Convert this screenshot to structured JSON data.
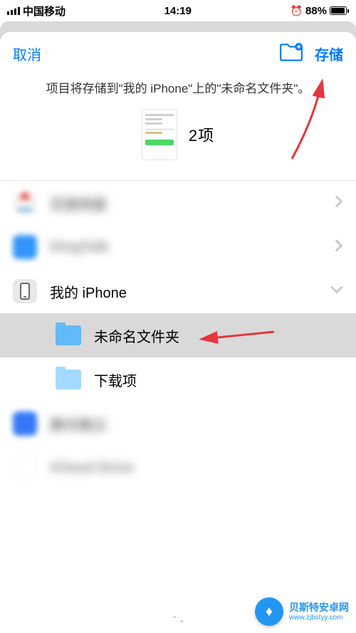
{
  "status": {
    "carrier": "中国移动",
    "time": "14:19",
    "battery": "88%"
  },
  "header": {
    "cancel": "取消",
    "save": "存储"
  },
  "description": "项目将存储到\"我的 iPhone\"上的\"未命名文件夹\"。",
  "preview": {
    "count": "2项"
  },
  "locations": [
    {
      "label": "百度网盘",
      "blurred": true,
      "iconColor": "#f5f5f5"
    },
    {
      "label": "DingTalk",
      "blurred": true,
      "iconColor": "#3296fa"
    },
    {
      "label": "我的 iPhone",
      "type": "phone",
      "expanded": true
    },
    {
      "label": "未命名文件夹",
      "type": "folder",
      "selected": true
    },
    {
      "label": "下载项",
      "type": "folder-light"
    },
    {
      "label": "腾讯微云",
      "blurred": true,
      "iconColor": "#3478f6"
    },
    {
      "label": "iCloud Drive",
      "blurred": true,
      "iconColor": "#fff"
    }
  ],
  "watermark": {
    "title": "贝斯特安卓网",
    "url": "www.zjbstyy.com"
  }
}
